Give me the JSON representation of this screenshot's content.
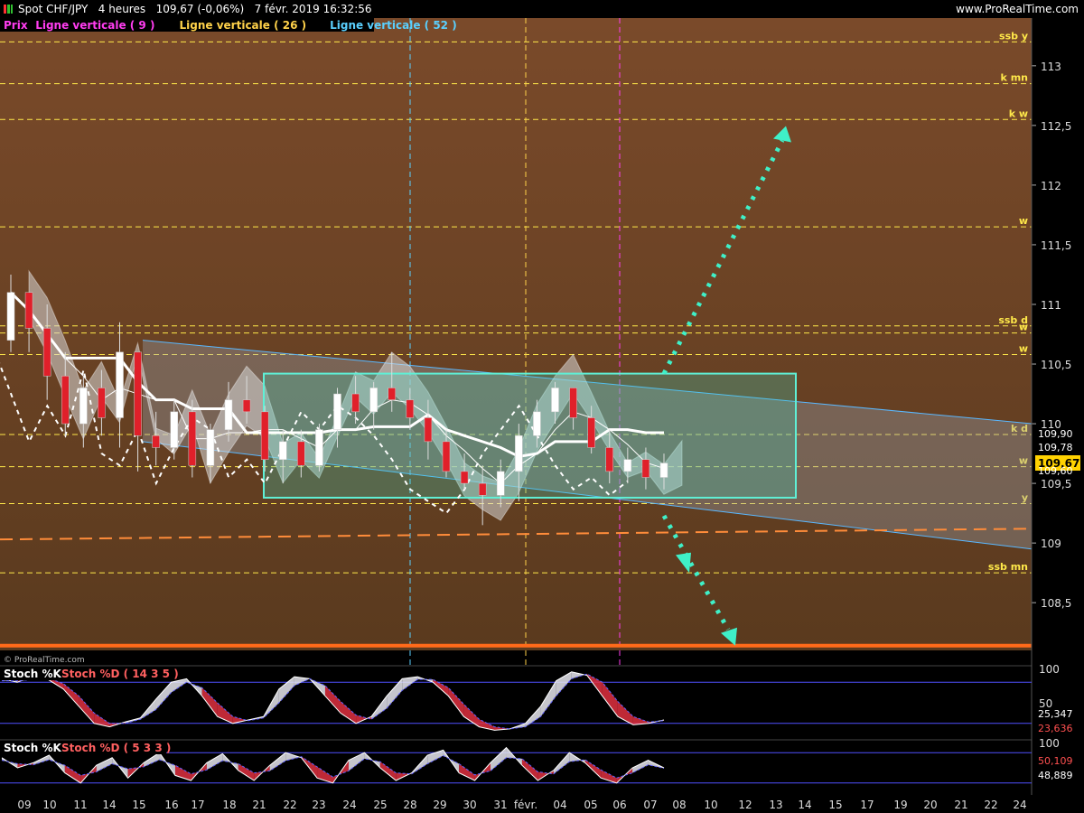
{
  "header": {
    "instrument": "Spot CHF/JPY",
    "timeframe": "4 heures",
    "last_change": "109,67 (-0,06%)",
    "datetime": "7 févr. 2019 16:32:56",
    "site": "www.ProRealTime.com",
    "watermark": "© ProRealTime.com"
  },
  "legend": [
    {
      "label": "Prix",
      "color": "#ff3df0"
    },
    {
      "label": "Ligne verticale ( 9 )",
      "color": "#ff3df0"
    },
    {
      "label": "Ligne verticale ( 26 )",
      "color": "#ffd24a"
    },
    {
      "label": "Ligne verticale ( 52 )",
      "color": "#5ad0ff"
    }
  ],
  "chart_data": [
    {
      "type": "candlestick",
      "panel": "price",
      "y_range": [
        108.1,
        113.4
      ],
      "y_ticks": [
        113,
        112.5,
        112,
        111.5,
        111,
        110.5,
        110,
        109.5,
        109,
        108.5
      ],
      "y_tick_labels": [
        "113",
        "112,5",
        "112",
        "111,5",
        "111",
        "110,5",
        "110",
        "109,5",
        "109",
        "108,5"
      ],
      "x_ticks": [
        "09",
        "10",
        "11",
        "14",
        "15",
        "16",
        "17",
        "18",
        "21",
        "22",
        "23",
        "24",
        "25",
        "28",
        "29",
        "30",
        "31",
        "févr.",
        "04",
        "05",
        "06",
        "07",
        "08",
        "10",
        "12",
        "13",
        "14",
        "15",
        "17",
        "19",
        "20",
        "21",
        "22",
        "24"
      ],
      "price_labels": [
        {
          "value": 109.9,
          "text": "109,90"
        },
        {
          "value": 109.78,
          "text": "109,78"
        },
        {
          "value": 109.67,
          "text": "109,67",
          "highlight": true
        },
        {
          "value": 109.6,
          "text": "109,60"
        }
      ],
      "levels": [
        {
          "label": "ssb y",
          "value": 113.2
        },
        {
          "label": "k mn",
          "value": 112.85
        },
        {
          "label": "k w",
          "value": 112.55
        },
        {
          "label": "w",
          "value": 111.65
        },
        {
          "label": "ssb d",
          "value": 110.82
        },
        {
          "label": "w",
          "value": 110.76
        },
        {
          "label": "w",
          "value": 110.58
        },
        {
          "label": "k d",
          "value": 109.91
        },
        {
          "label": "w",
          "value": 109.64
        },
        {
          "label": "y",
          "value": 109.33
        },
        {
          "label": "ssb mn",
          "value": 108.75
        }
      ],
      "vertical_lines": [
        {
          "after_label": "Ligne verticale ( 52 )",
          "position_date": "28",
          "color": "#5ad0ff"
        },
        {
          "after_label": "Ligne verticale ( 26 )",
          "position_date": "févr.",
          "color": "#ffd24a"
        },
        {
          "after_label": "Ligne verticale ( 9 )",
          "position_date": "06",
          "color": "#ff3df0"
        }
      ],
      "channel": {
        "upper_start": 110.7,
        "upper_end": 110.0,
        "lower_start": 109.85,
        "lower_end": 108.95,
        "from_date": "15",
        "to_date": "24"
      },
      "range_box": {
        "top": 110.42,
        "bottom": 109.38,
        "from_date": "21",
        "to_date": "13"
      },
      "projection_up_target": 112.45,
      "projection_down_target": 108.2,
      "support_line": {
        "start": 109.03,
        "end": 109.12
      },
      "floor_line": 108.14,
      "candles": [
        {
          "d": "09",
          "o": 110.7,
          "h": 111.25,
          "l": 110.6,
          "c": 111.1
        },
        {
          "d": "10",
          "o": 111.1,
          "h": 111.05,
          "l": 110.6,
          "c": 110.8
        },
        {
          "d": "10",
          "o": 110.8,
          "h": 111.0,
          "l": 110.2,
          "c": 110.4
        },
        {
          "d": "11",
          "o": 110.4,
          "h": 110.6,
          "l": 109.9,
          "c": 110.0
        },
        {
          "d": "14",
          "o": 110.0,
          "h": 110.4,
          "l": 109.8,
          "c": 110.3
        },
        {
          "d": "14",
          "o": 110.3,
          "h": 110.45,
          "l": 109.9,
          "c": 110.05
        },
        {
          "d": "15",
          "o": 110.05,
          "h": 110.85,
          "l": 109.8,
          "c": 110.6
        },
        {
          "d": "15",
          "o": 110.6,
          "h": 110.6,
          "l": 109.6,
          "c": 109.9
        },
        {
          "d": "16",
          "o": 109.9,
          "h": 110.1,
          "l": 109.65,
          "c": 109.8
        },
        {
          "d": "17",
          "o": 109.8,
          "h": 110.2,
          "l": 109.7,
          "c": 110.1
        },
        {
          "d": "17",
          "o": 110.1,
          "h": 110.2,
          "l": 109.55,
          "c": 109.65
        },
        {
          "d": "18",
          "o": 109.65,
          "h": 110.0,
          "l": 109.5,
          "c": 109.95
        },
        {
          "d": "18",
          "o": 109.95,
          "h": 110.35,
          "l": 109.85,
          "c": 110.2
        },
        {
          "d": "21",
          "o": 110.2,
          "h": 110.4,
          "l": 110.0,
          "c": 110.1
        },
        {
          "d": "22",
          "o": 110.1,
          "h": 110.15,
          "l": 109.6,
          "c": 109.7
        },
        {
          "d": "22",
          "o": 109.7,
          "h": 109.95,
          "l": 109.5,
          "c": 109.85
        },
        {
          "d": "23",
          "o": 109.85,
          "h": 109.95,
          "l": 109.55,
          "c": 109.65
        },
        {
          "d": "23",
          "o": 109.65,
          "h": 110.0,
          "l": 109.6,
          "c": 109.95
        },
        {
          "d": "24",
          "o": 109.95,
          "h": 110.3,
          "l": 109.8,
          "c": 110.25
        },
        {
          "d": "25",
          "o": 110.25,
          "h": 110.4,
          "l": 110.0,
          "c": 110.1
        },
        {
          "d": "25",
          "o": 110.1,
          "h": 110.35,
          "l": 109.95,
          "c": 110.3
        },
        {
          "d": "28",
          "o": 110.3,
          "h": 110.6,
          "l": 110.1,
          "c": 110.2
        },
        {
          "d": "29",
          "o": 110.2,
          "h": 110.3,
          "l": 109.95,
          "c": 110.05
        },
        {
          "d": "29",
          "o": 110.05,
          "h": 110.2,
          "l": 109.7,
          "c": 109.85
        },
        {
          "d": "30",
          "o": 109.85,
          "h": 109.95,
          "l": 109.55,
          "c": 109.6
        },
        {
          "d": "30",
          "o": 109.6,
          "h": 109.75,
          "l": 109.45,
          "c": 109.5
        },
        {
          "d": "31",
          "o": 109.5,
          "h": 109.65,
          "l": 109.15,
          "c": 109.4
        },
        {
          "d": "31",
          "o": 109.4,
          "h": 109.7,
          "l": 109.3,
          "c": 109.6
        },
        {
          "d": "févr.",
          "o": 109.6,
          "h": 110.0,
          "l": 109.35,
          "c": 109.9
        },
        {
          "d": "04",
          "o": 109.9,
          "h": 110.2,
          "l": 109.8,
          "c": 110.1
        },
        {
          "d": "04",
          "o": 110.1,
          "h": 110.35,
          "l": 110.0,
          "c": 110.3
        },
        {
          "d": "05",
          "o": 110.3,
          "h": 110.3,
          "l": 109.95,
          "c": 110.05
        },
        {
          "d": "05",
          "o": 110.05,
          "h": 110.15,
          "l": 109.75,
          "c": 109.8
        },
        {
          "d": "06",
          "o": 109.8,
          "h": 109.95,
          "l": 109.5,
          "c": 109.6
        },
        {
          "d": "06",
          "o": 109.6,
          "h": 109.8,
          "l": 109.5,
          "c": 109.7
        },
        {
          "d": "07",
          "o": 109.7,
          "h": 109.8,
          "l": 109.45,
          "c": 109.55
        },
        {
          "d": "07",
          "o": 109.55,
          "h": 109.75,
          "l": 109.45,
          "c": 109.67
        }
      ]
    },
    {
      "type": "line",
      "panel": "stoch1",
      "title": "Stoch %K",
      "subtitle": "Stoch %D ( 14 3 5 )",
      "y_range": [
        0,
        100
      ],
      "y_ticks": [
        100,
        50
      ],
      "levels": [
        80,
        20
      ],
      "last_labels": [
        {
          "text": "25,347",
          "color": "#ffffff"
        },
        {
          "text": "23,636",
          "color": "#ff5050"
        }
      ],
      "series": [
        {
          "values": [
            85,
            80,
            88,
            84,
            70,
            45,
            20,
            15,
            22,
            28,
            55,
            80,
            85,
            60,
            30,
            20,
            25,
            30,
            70,
            88,
            85,
            60,
            35,
            20,
            30,
            60,
            85,
            88,
            80,
            60,
            30,
            15,
            10,
            12,
            20,
            45,
            82,
            95,
            90,
            60,
            30,
            18,
            20,
            25
          ]
        },
        {
          "values": [
            82,
            82,
            84,
            86,
            78,
            60,
            35,
            20,
            20,
            26,
            40,
            65,
            80,
            72,
            50,
            30,
            24,
            28,
            50,
            75,
            85,
            75,
            52,
            32,
            26,
            42,
            68,
            84,
            84,
            72,
            48,
            26,
            15,
            12,
            15,
            30,
            60,
            85,
            92,
            80,
            52,
            30,
            22,
            24
          ]
        }
      ]
    },
    {
      "type": "line",
      "panel": "stoch2",
      "title": "Stoch %K",
      "subtitle": "Stoch %D ( 5 3 3 )",
      "y_range": [
        0,
        100
      ],
      "y_ticks": [
        100
      ],
      "levels": [
        80,
        20
      ],
      "last_labels": [
        {
          "text": "50,109",
          "color": "#ff5050"
        },
        {
          "text": "48,889",
          "color": "#ffffff"
        }
      ],
      "series": [
        {
          "values": [
            70,
            50,
            60,
            75,
            40,
            20,
            55,
            70,
            30,
            60,
            80,
            35,
            25,
            60,
            78,
            45,
            25,
            55,
            80,
            70,
            30,
            20,
            65,
            80,
            50,
            25,
            40,
            75,
            85,
            40,
            25,
            60,
            90,
            55,
            25,
            45,
            80,
            60,
            30,
            20,
            50,
            65,
            50
          ]
        },
        {
          "values": [
            65,
            58,
            56,
            66,
            55,
            35,
            42,
            58,
            48,
            52,
            66,
            55,
            38,
            46,
            64,
            58,
            40,
            44,
            64,
            72,
            52,
            32,
            44,
            68,
            62,
            40,
            38,
            58,
            74,
            58,
            36,
            44,
            70,
            68,
            42,
            38,
            62,
            66,
            46,
            30,
            40,
            56,
            49
          ]
        }
      ]
    }
  ]
}
